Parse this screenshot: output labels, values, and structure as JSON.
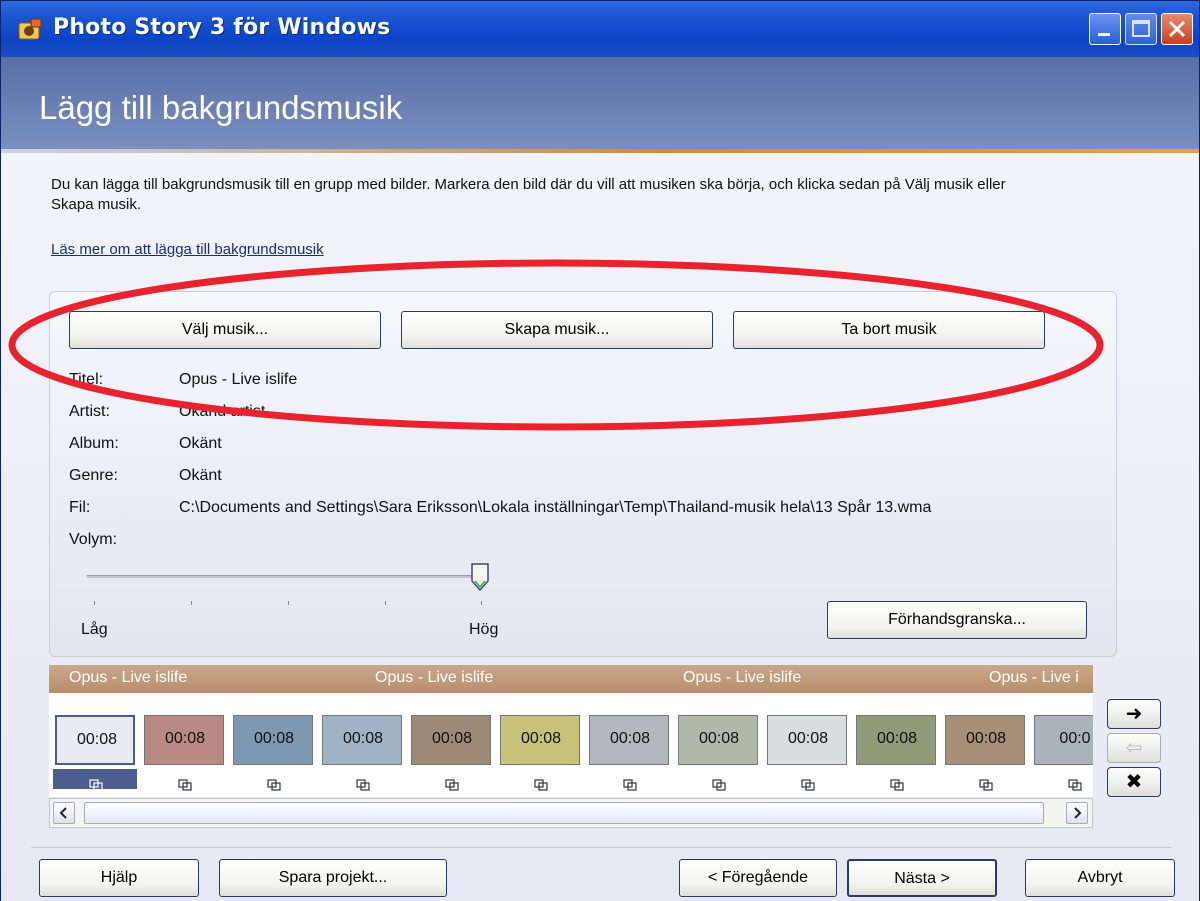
{
  "window": {
    "title": "Photo Story 3 för Windows",
    "controls": [
      "minimize",
      "maximize",
      "close"
    ]
  },
  "header": {
    "title": "Lägg till bakgrundsmusik"
  },
  "instructions": "Du kan lägga till bakgrundsmusik till en grupp med bilder. Markera den bild där du vill att musiken ska börja, och klicka sedan på Välj musik eller Skapa musik.",
  "help_link": "Läs mer om att lägga till bakgrundsmusik",
  "music_buttons": {
    "choose": "Välj musik...",
    "create": "Skapa musik...",
    "remove": "Ta bort musik"
  },
  "track_info": {
    "title_label": "Titel:",
    "title_value": "Opus - Live islife",
    "artist_label": "Artist:",
    "artist_value": "Okänd artist",
    "album_label": "Album:",
    "album_value": "Okänt",
    "genre_label": "Genre:",
    "genre_value": "Okänt",
    "file_label": "Fil:",
    "file_value": "C:\\Documents and Settings\\Sara Eriksson\\Lokala inställningar\\Temp\\Thailand-musik hela\\13 Spår 13.wma",
    "volume_label": "Volym:"
  },
  "volume": {
    "low_label": "Låg",
    "high_label": "Hög",
    "level": 1.0
  },
  "preview_button": "Förhandsgranska...",
  "music_track_labels": [
    "Opus - Live islife",
    "Opus - Live islife",
    "Opus - Live islife",
    "Opus - Live i"
  ],
  "filmstrip": {
    "thumbnails": [
      {
        "duration": "00:08",
        "color": "#e8ecf2"
      },
      {
        "duration": "00:08",
        "color": "#b98a84"
      },
      {
        "duration": "00:08",
        "color": "#7f98b2"
      },
      {
        "duration": "00:08",
        "color": "#9fb3c4"
      },
      {
        "duration": "00:08",
        "color": "#9c8a76"
      },
      {
        "duration": "00:08",
        "color": "#c7c27a"
      },
      {
        "duration": "00:08",
        "color": "#b4b8bc"
      },
      {
        "duration": "00:08",
        "color": "#b0b8a8"
      },
      {
        "duration": "00:08",
        "color": "#d8dcde"
      },
      {
        "duration": "00:08",
        "color": "#8e9a78"
      },
      {
        "duration": "00:08",
        "color": "#a89078"
      },
      {
        "duration": "00:0",
        "color": "#aab2bc"
      }
    ]
  },
  "side_buttons": {
    "next_arrow": "➜",
    "prev_arrow": "⇦",
    "delete": "✖"
  },
  "footer": {
    "help": "Hjälp",
    "save_project": "Spara projekt...",
    "previous": "< Föregående",
    "next": "Nästa >",
    "cancel": "Avbryt"
  },
  "colors": {
    "annotation": "#e8232e",
    "header": "#6478ae",
    "accent": "#d58a3a"
  }
}
